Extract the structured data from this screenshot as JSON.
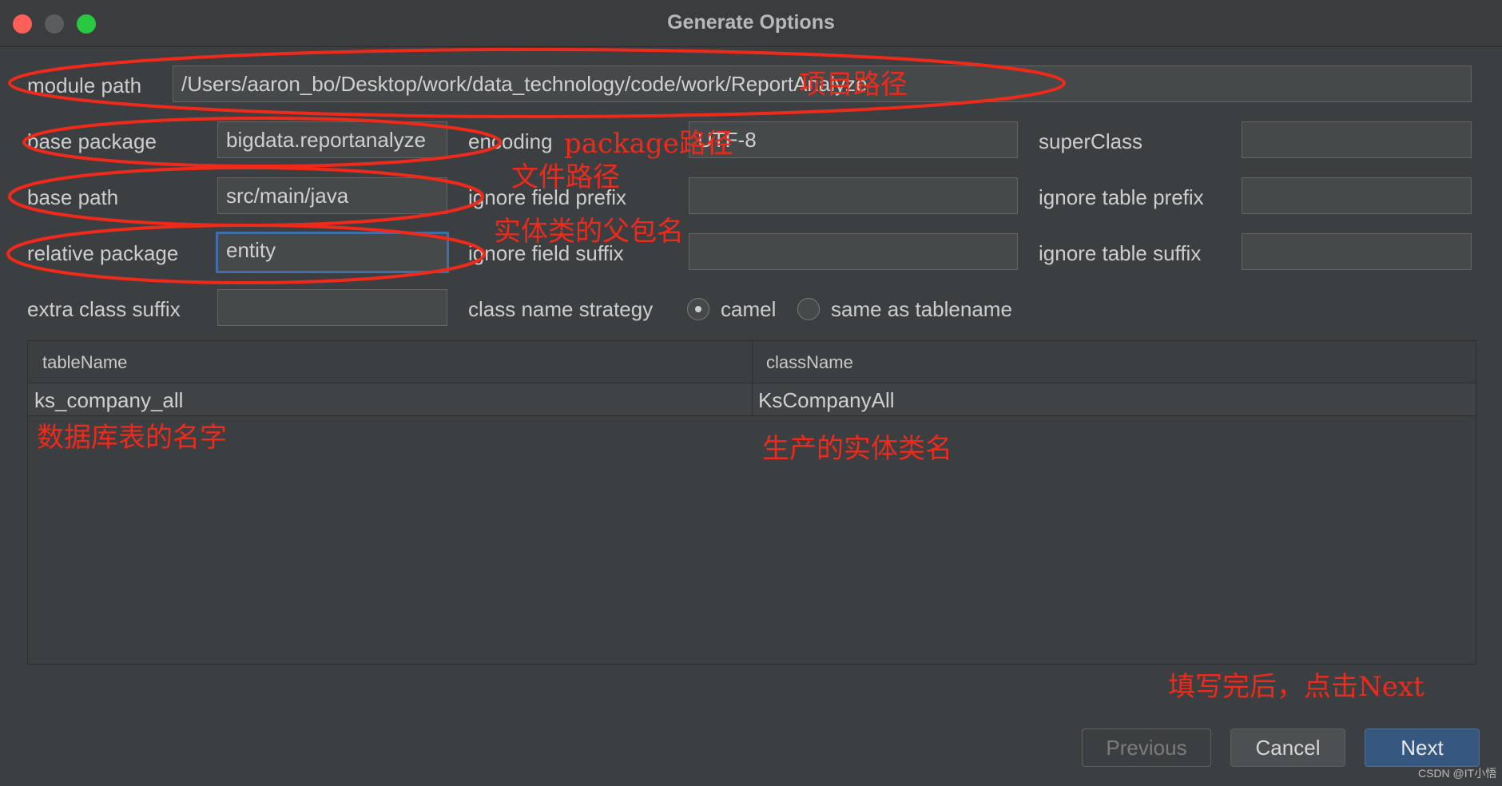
{
  "window": {
    "title": "Generate Options"
  },
  "form": {
    "module_path_label": "module path",
    "module_path_value": "/Users/aaron_bo/Desktop/work/data_technology/code/work/ReportAnalyze",
    "base_package_label": "base package",
    "base_package_value": "bigdata.reportanalyze",
    "encoding_label": "encoding",
    "encoding_value": "UTF-8",
    "superclass_label": "superClass",
    "superclass_value": "",
    "base_path_label": "base path",
    "base_path_value": "src/main/java",
    "ignore_field_prefix_label": "ignore field prefix",
    "ignore_field_prefix_value": "",
    "ignore_table_prefix_label": "ignore table prefix",
    "ignore_table_prefix_value": "",
    "relative_package_label": "relative package",
    "relative_package_value": "entity",
    "ignore_field_suffix_label": "ignore field suffix",
    "ignore_field_suffix_value": "",
    "ignore_table_suffix_label": "ignore table suffix",
    "ignore_table_suffix_value": "",
    "extra_class_suffix_label": "extra class suffix",
    "extra_class_suffix_value": "",
    "class_name_strategy_label": "class name strategy",
    "strategy_options": [
      "camel",
      "same as tablename"
    ],
    "strategy_selected": "camel"
  },
  "table": {
    "columns": [
      "tableName",
      "className"
    ],
    "rows": [
      [
        "ks_company_all",
        "KsCompanyAll"
      ]
    ]
  },
  "buttons": {
    "previous": "Previous",
    "cancel": "Cancel",
    "next": "Next"
  },
  "annotations": {
    "project_path": "项目路径",
    "package_path": "package路径",
    "file_path": "文件路径",
    "entity_parent_package": "实体类的父包名",
    "table_name_note": "数据库表的名字",
    "entity_class_name_note": "生产的实体类名",
    "next_note": "填写完后，点击Next"
  },
  "watermark": "CSDN @IT小悟",
  "colors": {
    "background": "#3c3f41",
    "annotation": "#f02a1a",
    "primary_button": "#365880"
  }
}
